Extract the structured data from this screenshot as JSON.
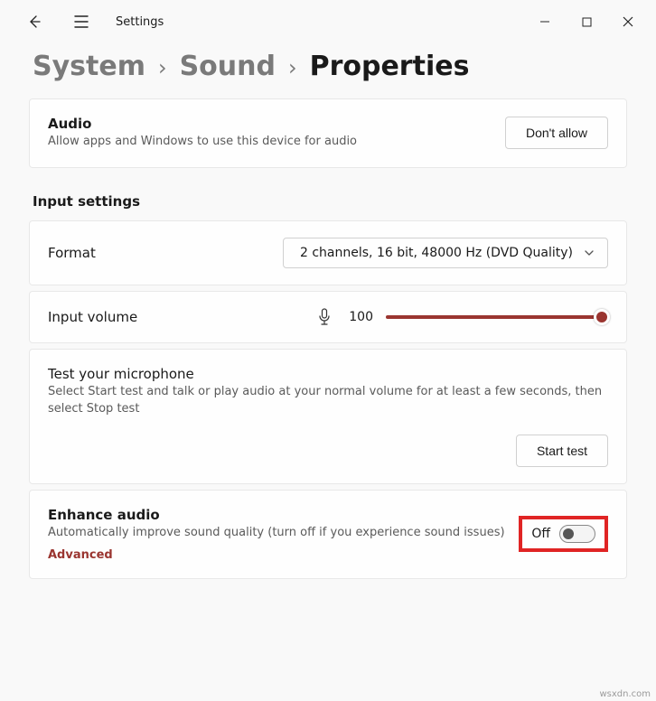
{
  "titlebar": {
    "app_title": "Settings"
  },
  "breadcrumb": {
    "items": [
      "System",
      "Sound",
      "Properties"
    ]
  },
  "audio_card": {
    "title": "Audio",
    "desc": "Allow apps and Windows to use this device for audio",
    "button": "Don't allow"
  },
  "input_settings": {
    "heading": "Input settings"
  },
  "format": {
    "label": "Format",
    "value": "2 channels, 16 bit, 48000 Hz (DVD Quality)"
  },
  "volume": {
    "label": "Input volume",
    "value": "100"
  },
  "test": {
    "title": "Test your microphone",
    "desc": "Select Start test and talk or play audio at your normal volume for at least a few seconds, then select Stop test",
    "button": "Start test"
  },
  "enhance": {
    "title": "Enhance audio",
    "desc": "Automatically improve sound quality (turn off if you experience sound issues)",
    "advanced": "Advanced",
    "toggle_state": "Off"
  },
  "watermark": "wsxdn.com"
}
